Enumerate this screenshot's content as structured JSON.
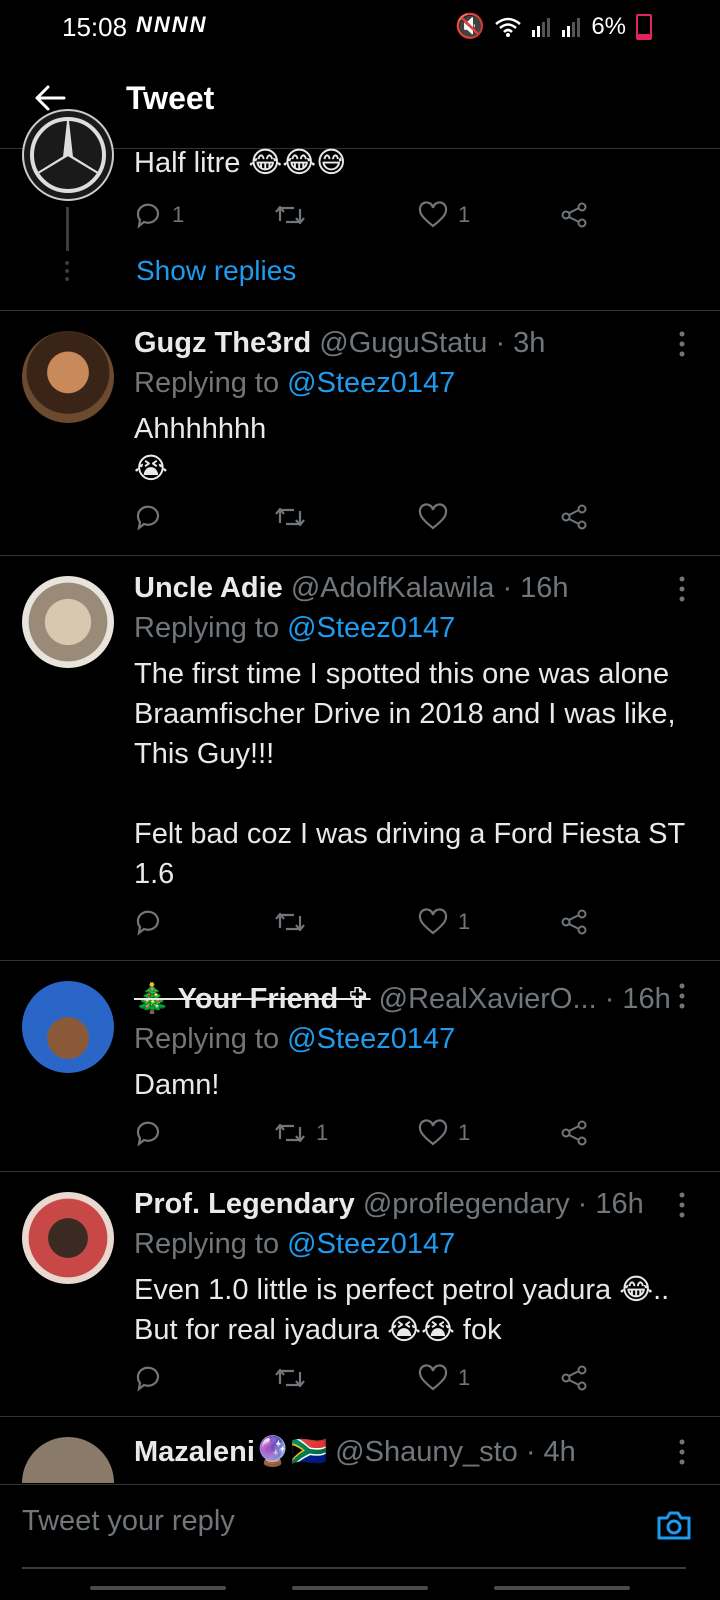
{
  "status_bar": {
    "time": "15:08",
    "notifications": "NNNN",
    "battery": "6%"
  },
  "app_bar": {
    "title": "Tweet"
  },
  "top_tweet": {
    "text": "Half litre 😂😂😅",
    "reply_count": "1",
    "like_count": "1",
    "show_replies": "Show replies"
  },
  "tweets": [
    {
      "name": "Gugz The3rd",
      "handle": "@GuguStatu · 3h",
      "replying_label": "Replying to ",
      "mention": "@Steez0147",
      "text": "Ahhhhhhh\n😭",
      "reply_count": "",
      "retweet_count": "",
      "like_count": ""
    },
    {
      "name": "Uncle Adie",
      "handle": "@AdolfKalawila · 16h",
      "replying_label": "Replying to ",
      "mention": "@Steez0147",
      "text": "The first time I spotted this one was alone Braamfischer Drive in 2018 and I was like, This Guy!!!\n\nFelt bad coz I was driving a Ford Fiesta ST 1.6",
      "reply_count": "",
      "retweet_count": "",
      "like_count": "1"
    },
    {
      "name": "🎄 Your Friend ✞",
      "handle": "@RealXavierO... · 16h",
      "replying_label": "Replying to ",
      "mention": "@Steez0147",
      "text": "Damn!",
      "reply_count": "",
      "retweet_count": "1",
      "like_count": "1"
    },
    {
      "name": "Prof. Legendary",
      "handle": "@proflegendary · 16h",
      "replying_label": "Replying to ",
      "mention": "@Steez0147",
      "text": "Even 1.0 little is perfect petrol yadura 😂.. But for real iyadura 😭😭 fok",
      "reply_count": "",
      "retweet_count": "",
      "like_count": "1"
    }
  ],
  "partial_tweet": {
    "name": "Mazaleni🔮🇿🇦",
    "handle": "@Shauny_sto · 4h"
  },
  "reply_bar": {
    "placeholder": "Tweet your reply"
  },
  "colors": {
    "background": "#000000",
    "accent": "#1d9bf0",
    "muted": "#71767b",
    "text": "#e7e9ea",
    "divider": "#2f3336"
  }
}
